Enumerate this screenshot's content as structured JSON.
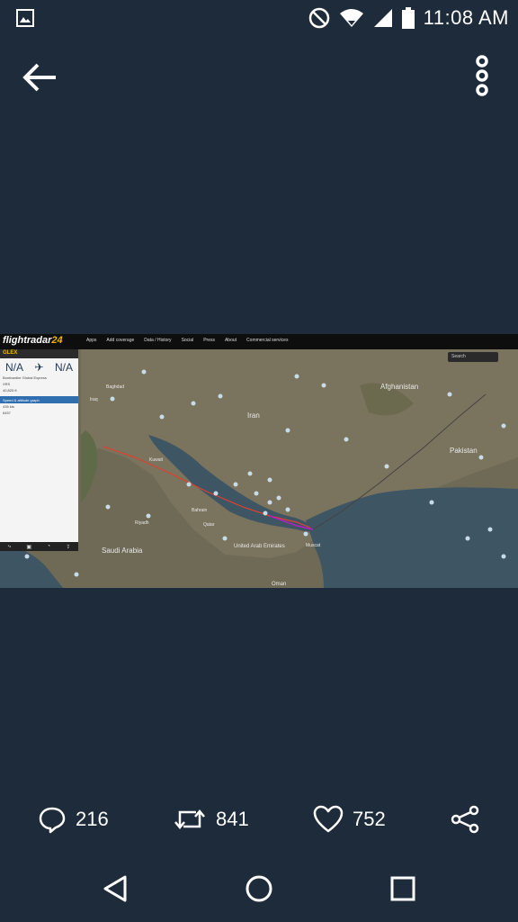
{
  "status_bar": {
    "time": "11:08 AM"
  },
  "icons": {
    "gallery": "image-icon",
    "dnd": "do-not-disturb-icon",
    "wifi": "wifi-icon",
    "signal": "signal-icon",
    "battery": "battery-icon",
    "back": "arrow-left-icon",
    "more": "more-vertical-icon",
    "reply": "comment-icon",
    "retweet": "retweet-icon",
    "like": "heart-icon",
    "share": "share-icon"
  },
  "media": {
    "logo_name": "flightradar",
    "logo_num": "24",
    "nav_items": [
      "Apps",
      "Add coverage",
      "Data / History",
      "Social",
      "Press",
      "About",
      "Commercial services"
    ],
    "search_label": "Search",
    "panel": {
      "callsign": "GLEX",
      "origin": "N/A",
      "destination": "N/A",
      "aircraft_type": "Bombardier Global Express",
      "registration": "XRS",
      "altitude": "40,825 ft",
      "section_label": "Speed & altitude graph",
      "ground_speed": "435 kts",
      "squawk": "6457"
    },
    "map_labels": {
      "afghanistan": "Afghanistan",
      "iran": "Iran",
      "pakistan": "Pakistan",
      "saudi_arabia": "Saudi Arabia",
      "uae": "United Arab Emirates",
      "oman": "Oman",
      "qatar": "Qatar",
      "bahrain": "Bahrain",
      "kuwait": "Kuwait",
      "baghdad": "Baghdad",
      "iraq": "Iraq",
      "muscat": "Muscat",
      "riyadh": "Riyadh"
    }
  },
  "actions": {
    "replies": "216",
    "retweets": "841",
    "likes": "752"
  },
  "accent": "#f2b600",
  "background": "#1d2b3a"
}
